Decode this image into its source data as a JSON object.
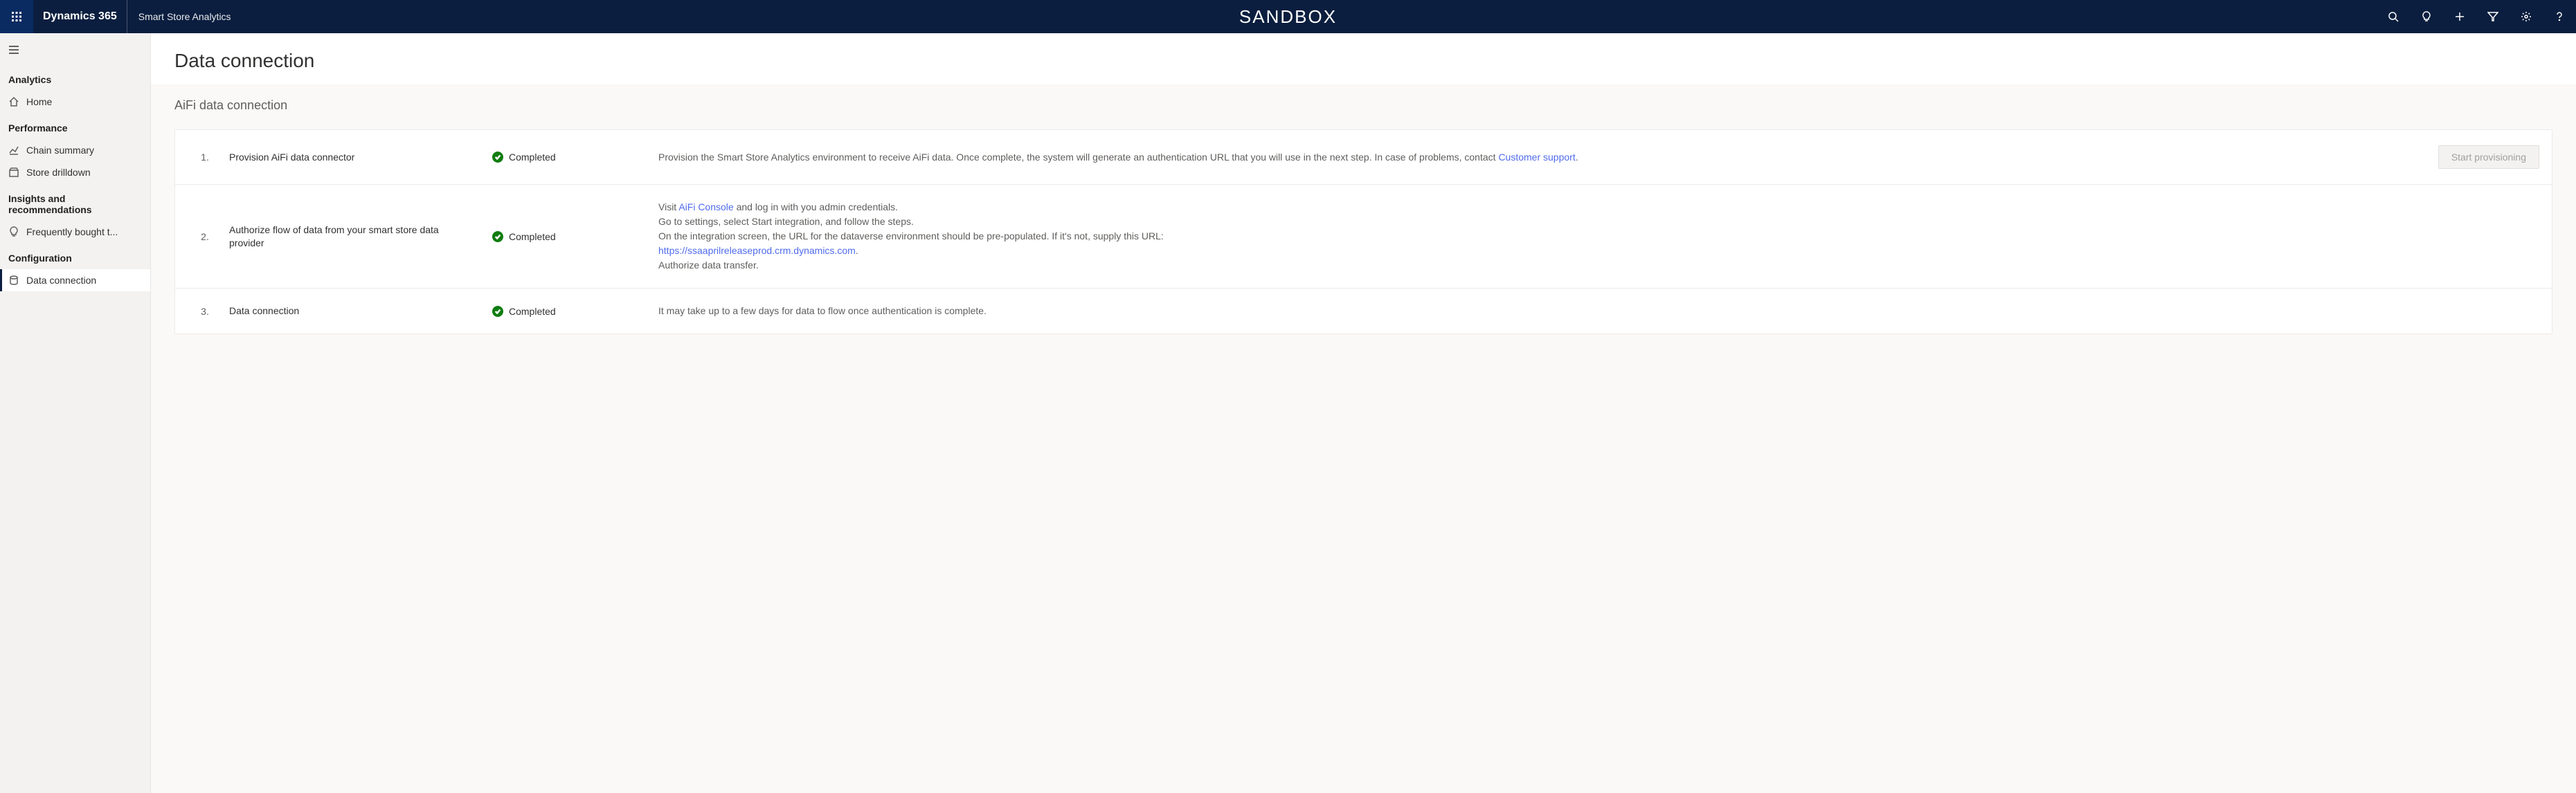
{
  "header": {
    "brand": "Dynamics 365",
    "app": "Smart Store Analytics",
    "env": "SANDBOX"
  },
  "sidebar": {
    "sections": [
      {
        "title": "Analytics",
        "items": [
          {
            "label": "Home",
            "icon": "home"
          }
        ]
      },
      {
        "title": "Performance",
        "items": [
          {
            "label": "Chain summary",
            "icon": "chart"
          },
          {
            "label": "Store drilldown",
            "icon": "store"
          }
        ]
      },
      {
        "title": "Insights and recommendations",
        "items": [
          {
            "label": "Frequently bought t...",
            "icon": "idea"
          }
        ]
      },
      {
        "title": "Configuration",
        "items": [
          {
            "label": "Data connection",
            "icon": "data",
            "active": true
          }
        ]
      }
    ]
  },
  "page": {
    "title": "Data connection",
    "section_title": "AiFi data connection",
    "steps": [
      {
        "num": "1.",
        "title": "Provision AiFi data connector",
        "status": "Completed",
        "desc_pre": "Provision the Smart Store Analytics environment to receive AiFi data. Once complete, the system will generate an authentication URL that you will use in the next step. In case of problems, contact ",
        "link1": "Customer support",
        "desc_post": ".",
        "button": "Start provisioning"
      },
      {
        "num": "2.",
        "title": "Authorize flow of data from your smart store data provider",
        "status": "Completed",
        "l1_pre": "Visit ",
        "l1_link": "AiFi Console",
        "l1_post": " and log in with you admin credentials.",
        "l2": "Go to settings, select Start integration, and follow the steps.",
        "l3": "On the integration screen, the URL for the dataverse environment should be pre-populated. If it's not, supply this URL:",
        "l4_link": "https://ssaaprilreleaseprod.crm.dynamics.com",
        "l4_post": ".",
        "l5": "Authorize data transfer."
      },
      {
        "num": "3.",
        "title": "Data connection",
        "status": "Completed",
        "desc": "It may take up to a few days for data to flow once authentication is complete."
      }
    ]
  }
}
